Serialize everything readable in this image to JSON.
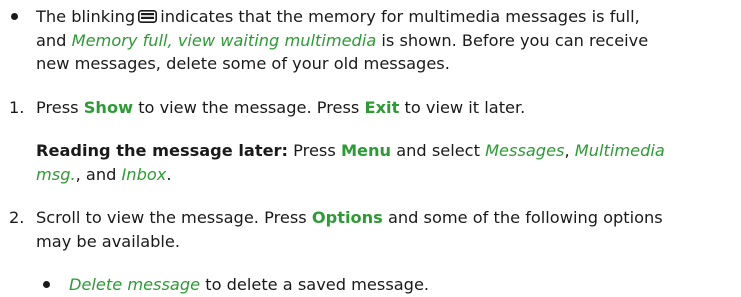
{
  "bullet_memory": {
    "text_a": "The blinking",
    "icon": "envelope-icon",
    "text_b": "indicates that the memory for multimedia messages is full,",
    "text_c": "and",
    "link_memory_full": "Memory full, view waiting multimedia",
    "text_d": "is shown. Before you can receive",
    "text_e": "new messages, delete some of your old messages."
  },
  "step1": {
    "number": "1.",
    "text_a": "Press",
    "show": "Show",
    "text_b": "to view the message. Press",
    "exit": "Exit",
    "text_c": "to view it later."
  },
  "reading_later": {
    "label": "Reading the message later:",
    "text_a": "Press",
    "menu": "Menu",
    "text_b": "and select",
    "messages": "Messages",
    "comma1": ",",
    "multimedia": "Multimedia",
    "multimedia_msg": "msg.",
    "text_c": ", and",
    "inbox": "Inbox",
    "period": "."
  },
  "step2": {
    "number": "2.",
    "text_a": "Scroll to view the message. Press",
    "options": "Options",
    "text_b": "and some of the following options",
    "text_c": "may be available."
  },
  "bullet_delete": {
    "link_delete": "Delete message",
    "text_a": "to delete a saved message."
  },
  "colors": {
    "accent_green": "#2e9a36",
    "text": "#1a1a1a"
  }
}
